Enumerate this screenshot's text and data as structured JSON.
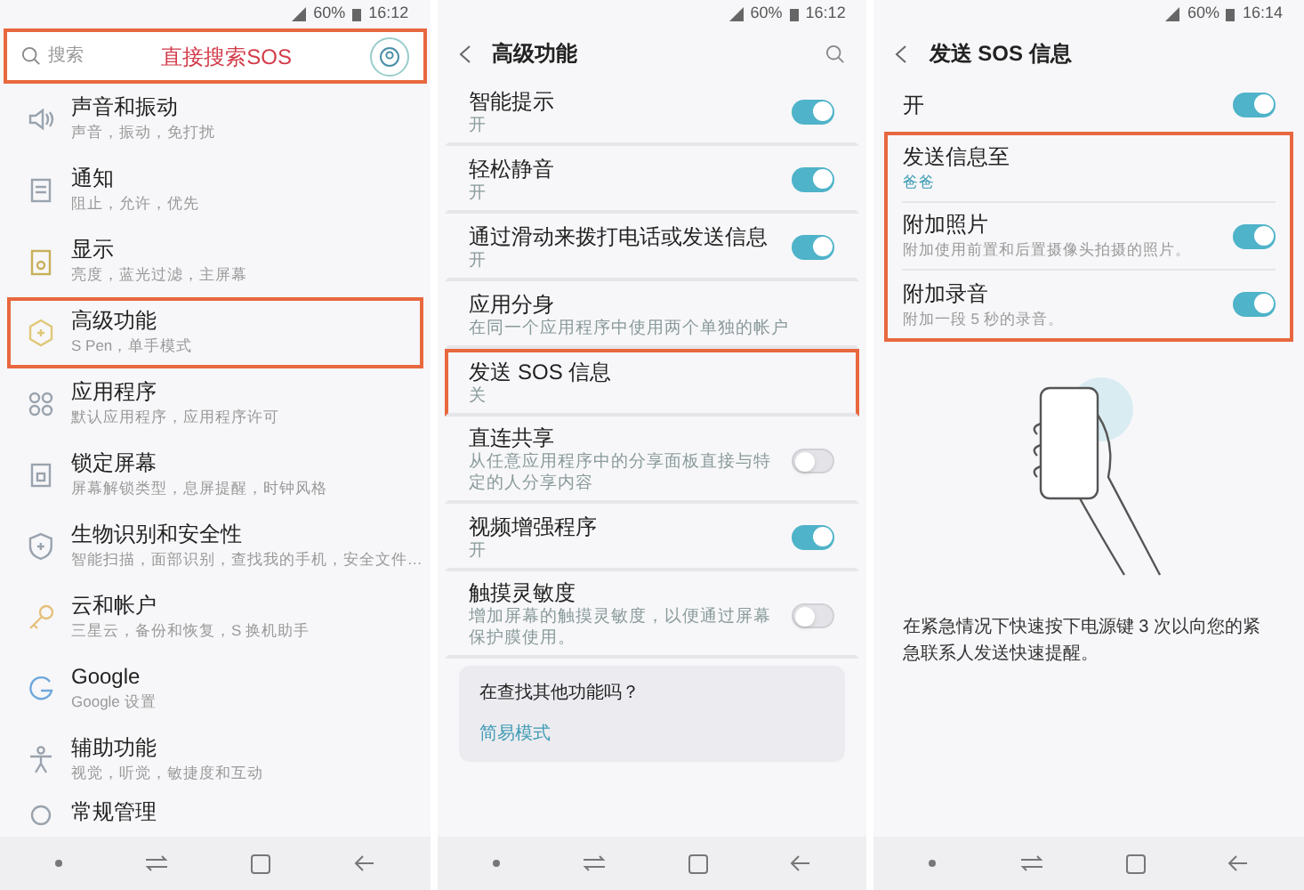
{
  "panels": [
    {
      "status": {
        "battery": "60%",
        "time": "16:12"
      },
      "search": {
        "placeholder": "搜索",
        "highlighted": true
      },
      "annotation": "直接搜索SOS",
      "items": [
        {
          "title": "声音和振动",
          "subtitle": "声音，振动，免打扰",
          "highlighted": false
        },
        {
          "title": "通知",
          "subtitle": "阻止，允许，优先",
          "highlighted": false
        },
        {
          "title": "显示",
          "subtitle": "亮度，蓝光过滤，主屏幕",
          "highlighted": false
        },
        {
          "title": "高级功能",
          "subtitle": "S Pen，单手模式",
          "highlighted": true
        },
        {
          "title": "应用程序",
          "subtitle": "默认应用程序，应用程序许可",
          "highlighted": false
        },
        {
          "title": "锁定屏幕",
          "subtitle": "屏幕解锁类型，息屏提醒，时钟风格",
          "highlighted": false
        },
        {
          "title": "生物识别和安全性",
          "subtitle": "智能扫描，面部识别，查找我的手机，安全文件…",
          "highlighted": false
        },
        {
          "title": "云和帐户",
          "subtitle": "三星云，备份和恢复，S 换机助手",
          "highlighted": false
        },
        {
          "title": "Google",
          "subtitle": "Google 设置",
          "highlighted": false
        },
        {
          "title": "辅助功能",
          "subtitle": "视觉，听觉，敏捷度和互动",
          "highlighted": false
        },
        {
          "title": "常规管理",
          "highlighted": false
        }
      ]
    },
    {
      "status": {
        "battery": "60%",
        "time": "16:12"
      },
      "title": "高级功能",
      "items": [
        {
          "kind": "toggle",
          "title": "智能提示",
          "subtitle": "开",
          "on": true,
          "highlighted": false
        },
        {
          "kind": "toggle",
          "title": "轻松静音",
          "subtitle": "开",
          "on": true,
          "highlighted": false
        },
        {
          "kind": "toggle",
          "title": "通过滑动来拨打电话或发送信息",
          "subtitle": "开",
          "on": true,
          "highlighted": false
        },
        {
          "kind": "plain",
          "title": "应用分身",
          "subtitle": "在同一个应用程序中使用两个单独的帐户",
          "highlighted": false
        },
        {
          "kind": "plain",
          "title": "发送 SOS 信息",
          "subtitle": "关",
          "highlighted": true
        },
        {
          "kind": "toggle",
          "title": "直连共享",
          "subtitle": "从任意应用程序中的分享面板直接与特定的人分享内容",
          "on": false,
          "highlighted": false
        },
        {
          "kind": "toggle",
          "title": "视频增强程序",
          "subtitle": "开",
          "on": true,
          "highlighted": false
        },
        {
          "kind": "toggle",
          "title": "触摸灵敏度",
          "subtitle": "增加屏幕的触摸灵敏度，以便通过屏幕保护膜使用。",
          "on": false,
          "highlighted": false
        }
      ],
      "card": {
        "title": "在查找其他功能吗？",
        "link": "简易模式"
      }
    },
    {
      "status": {
        "battery": "60%",
        "time": "16:14"
      },
      "title": "发送 SOS 信息",
      "master": {
        "label": "开",
        "on": true
      },
      "items": [
        {
          "kind": "value",
          "title": "发送信息至",
          "subtitle": "爸爸"
        },
        {
          "kind": "toggle",
          "title": "附加照片",
          "subtitle": "附加使用前置和后置摄像头拍摄的照片。",
          "on": true
        },
        {
          "kind": "toggle",
          "title": "附加录音",
          "subtitle": "附加一段 5 秒的录音。",
          "on": true
        }
      ],
      "group_highlighted": true,
      "description": "在紧急情况下快速按下电源键 3 次以向您的紧急联系人发送快速提醒。"
    }
  ]
}
